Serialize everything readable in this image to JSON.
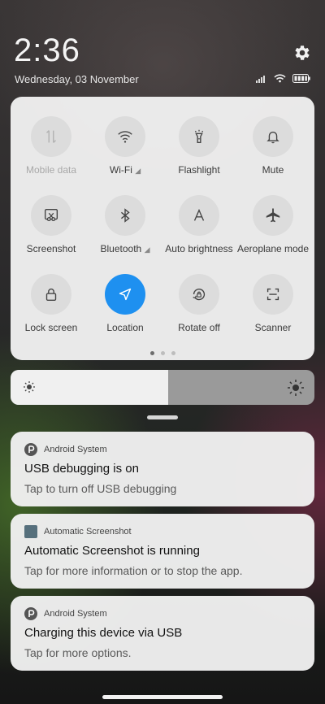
{
  "status": {
    "time": "2:36",
    "date": "Wednesday, 03 November",
    "icons": [
      "signal-icon",
      "wifi-icon",
      "battery-icon"
    ]
  },
  "quick_settings": {
    "tiles": [
      {
        "label": "Mobile data",
        "icon": "mobile-data-icon",
        "state": "disabled"
      },
      {
        "label": "Wi-Fi",
        "icon": "wifi-icon",
        "state": "off"
      },
      {
        "label": "Flashlight",
        "icon": "flashlight-icon",
        "state": "off"
      },
      {
        "label": "Mute",
        "icon": "bell-icon",
        "state": "off"
      },
      {
        "label": "Screenshot",
        "icon": "screenshot-icon",
        "state": "off"
      },
      {
        "label": "Bluetooth",
        "icon": "bluetooth-icon",
        "state": "off"
      },
      {
        "label": "Auto brightness",
        "icon": "auto-brightness-icon",
        "state": "off"
      },
      {
        "label": "Aeroplane mode",
        "icon": "airplane-icon",
        "state": "off"
      },
      {
        "label": "Lock screen",
        "icon": "lock-icon",
        "state": "off"
      },
      {
        "label": "Location",
        "icon": "location-icon",
        "state": "on"
      },
      {
        "label": "Rotate off",
        "icon": "rotate-icon",
        "state": "off"
      },
      {
        "label": "Scanner",
        "icon": "scanner-icon",
        "state": "off"
      }
    ],
    "page_count": 3,
    "current_page": 1
  },
  "brightness": {
    "level": 0.52
  },
  "notifications": [
    {
      "app": "Android System",
      "app_icon": "android-system-icon",
      "title": "USB debugging is on",
      "text": "Tap to turn off USB debugging"
    },
    {
      "app": "Automatic Screenshot",
      "app_icon": "automatic-screenshot-icon",
      "title": "Automatic Screenshot is running",
      "text": "Tap for more information or to stop the app."
    },
    {
      "app": "Android System",
      "app_icon": "android-system-icon",
      "title": "Charging this device via USB",
      "text": "Tap for more options."
    }
  ],
  "colors": {
    "accent": "#1e90f0",
    "panel": "#f0f0f0",
    "tile_bg": "#dcdcdc"
  }
}
